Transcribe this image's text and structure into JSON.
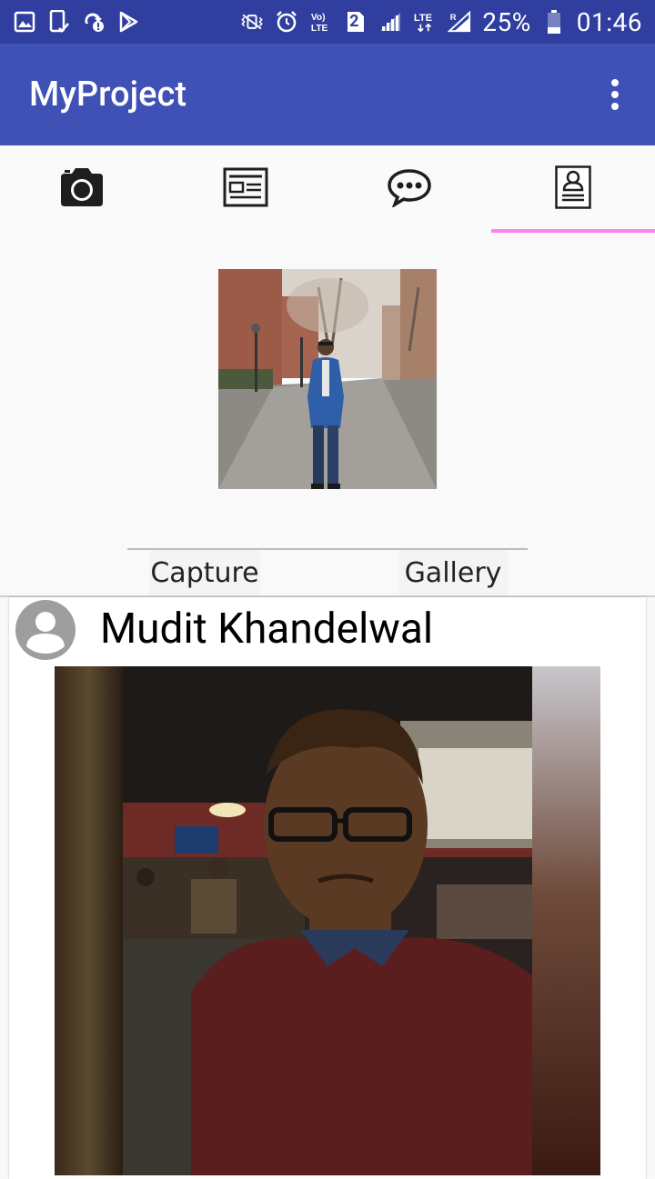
{
  "status_bar": {
    "battery": "25%",
    "time": "01:46",
    "sim": "2",
    "network": "LTE"
  },
  "app_bar": {
    "title": "MyProject",
    "overflow_icon": "more-vert-icon"
  },
  "tabs": [
    {
      "icon": "camera-icon"
    },
    {
      "icon": "news-feed-icon"
    },
    {
      "icon": "chat-bubble-icon"
    },
    {
      "icon": "profile-id-icon",
      "active": true
    }
  ],
  "profile": {
    "capture_label": "Capture",
    "gallery_label": "Gallery"
  },
  "post": {
    "author": "Mudit Khandelwal"
  },
  "colors": {
    "status_bar": "#303f9f",
    "primary": "#3f51b5",
    "tab_indicator": "#ff80f0"
  }
}
